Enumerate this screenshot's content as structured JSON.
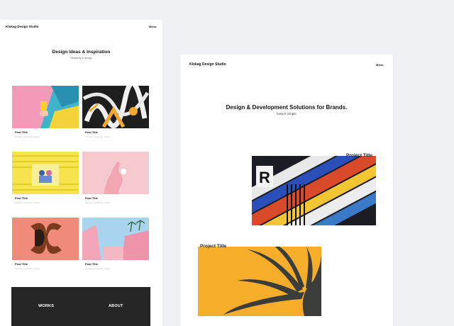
{
  "left_preview": {
    "brand": "Klokag Design Studio",
    "menu": "Menu",
    "hero_title": "Design Ideas & Inspiration",
    "hero_sub": "Simplicity in design",
    "posts": [
      {
        "title": "Post Title",
        "cats": "Portraits, Landscape, Nature"
      },
      {
        "title": "Post Title",
        "cats": "Portraits, Landscape, Nature"
      },
      {
        "title": "Post Title",
        "cats": "Portraits, Landscape, Nature"
      },
      {
        "title": "Post Title",
        "cats": "Portraits, Landscape, Nature"
      },
      {
        "title": "Post Title",
        "cats": "Portraits, Landscape, Nature"
      },
      {
        "title": "Post Title",
        "cats": "Portraits, Landscape, Nature"
      }
    ],
    "footer": {
      "works": "WORKS",
      "about": "ABOUT"
    }
  },
  "right_preview": {
    "brand": "Klokag Design Studio",
    "menu": "Menu",
    "hero_title": "Design & Development Solutions for Brands.",
    "hero_sub": "keep it simple",
    "projects": [
      {
        "title": "Project Title"
      },
      {
        "title": "Project Title"
      }
    ]
  }
}
